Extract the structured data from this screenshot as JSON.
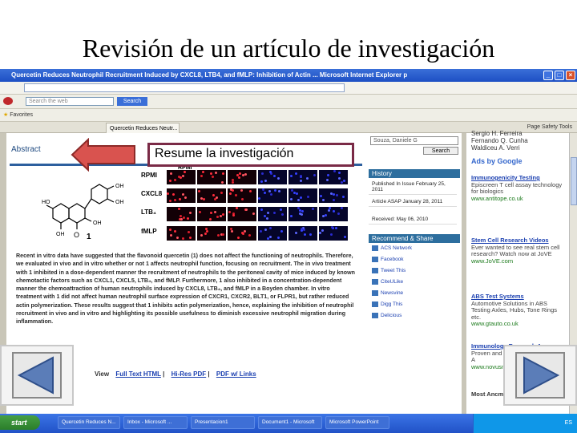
{
  "slide": {
    "title": "Revisión de un artículo de investigación",
    "callout_text": "Resume  la investigación"
  },
  "browser": {
    "window_title": "Quercetin Reduces Neutrophil Recruitment Induced by CXCL8, LTB4, and fMLP: Inhibition of Actin ... Microsoft Internet Explorer p",
    "search_placeholder": "Search the web",
    "search_button": "Search",
    "favorites_label": "Favorites",
    "tab_label": "Quercetin Reduces Neutr...",
    "toolbar_right": "Page  Safety  Tools"
  },
  "article": {
    "abstract_heading": "Abstract",
    "figure_header_label": "RPMI",
    "figure_compound_label": "1",
    "row_labels": [
      "RPMI",
      "CXCL8",
      "LTB₄",
      "fMLP"
    ],
    "abstract_text": "Recent in vitro data have suggested that the flavonoid quercetin (1) does not affect the functioning of neutrophils. Therefore, we evaluated in vivo and in vitro whether or not 1 affects neutrophil function, focusing on recruitment. The in vivo treatment with 1 inhibited in a dose-dependent manner the recruitment of neutrophils to the peritoneal cavity of mice induced by known chemotactic factors such as CXCL1, CXCL5, LTB₄, and fMLP. Furthermore, 1 also inhibited in a concentration-dependent manner the chemoattraction of human neutrophils induced by CXCL8, LTB₄, and fMLP in a Boyden chamber. In vitro treatment with 1 did not affect human neutrophil surface expression of CXCR1, CXCR2, BLT1, or FLPR1, but rather reduced actin polymerization. These results suggest that 1 inhibits actin polymerization, hence, explaining the inhibition of neutrophil recruitment in vivo and in vitro and highlighting its possible usefulness to diminish excessive neutrophil migration during inflammation.",
    "view_label": "View",
    "view_links": [
      "Full Text HTML",
      "Hi-Res PDF",
      "PDF w/ Links"
    ]
  },
  "sidebar": {
    "search_value": "Souza, Daniele G",
    "search_button": "Search",
    "history_heading": "History",
    "history_items": [
      "Published In Issue February 25, 2011",
      "Article ASAP January 28, 2011",
      "Received: May 06, 2010"
    ],
    "recommend_heading": "Recommend & Share",
    "recommend_items": [
      "ACS Network",
      "Facebook",
      "Tweet This",
      "CiteULike",
      "Newsvine",
      "Digg This",
      "Delicious"
    ]
  },
  "ads": {
    "authors": [
      "Sergio H. Ferreira",
      "Fernando Q. Cunha",
      "Waldiceu A. Verri"
    ],
    "ads_by": "Ads by Google",
    "items": [
      {
        "title": "Immunogenicity Testing",
        "body": "Episcreen T cell assay technology for biologics",
        "url": "www.antitope.co.uk"
      },
      {
        "title": "Stem Cell Research Videos",
        "body": "Ever wanted to see real stem cell research? Watch now at JoVE",
        "url": "www.JoVE.com"
      },
      {
        "title": "ABS Test Systems",
        "body": "Automotive Solutions in ABS Testing Axles, Hubs, Tone Rings etc.",
        "url": "www.gtauto.co.uk"
      },
      {
        "title": "Immunology Research A",
        "body": "Proven and Immune Re Research A",
        "url": "www.novusm"
      }
    ],
    "more_label": "Most Ancm"
  },
  "taskbar": {
    "start": "start",
    "tasks": [
      "Quercetin Reduces N...",
      "Inbox - Microsoft ...",
      "Presentacion1",
      "Document1 - Microsoft",
      "Microsoft PowerPoint"
    ],
    "clock": "ES"
  }
}
